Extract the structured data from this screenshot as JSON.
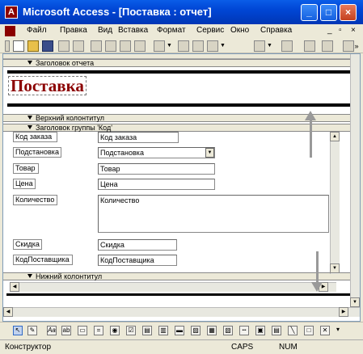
{
  "window": {
    "title": "Microsoft Access - [Поставка : отчет]",
    "buttons": [
      "minimize",
      "maximize",
      "close"
    ]
  },
  "menu": {
    "items": [
      "Файл",
      "Правка",
      "Вид",
      "Вставка",
      "Формат",
      "Сервис",
      "Окно",
      "Справка"
    ]
  },
  "report": {
    "title": "Поставка",
    "sections": {
      "report_header": "Заголовок отчета",
      "page_header": "Верхний колонтитул",
      "group_header": "Заголовок группы 'Код'",
      "page_footer": "Нижний колонтитул"
    },
    "rows": [
      {
        "label": "Код заказа",
        "field": "Код заказа"
      },
      {
        "label": "Подстановка",
        "field": "Подстановка"
      },
      {
        "label": "Товар",
        "field": "Товар"
      },
      {
        "label": "Цена",
        "field": "Цена"
      },
      {
        "label": "Количество",
        "field": "Количество"
      },
      {
        "label": "Скидка",
        "field": "Скидка"
      },
      {
        "label": "КодПоставщика",
        "field": "КодПоставщика"
      }
    ]
  },
  "status": {
    "mode": "Конструктор",
    "caps": "CAPS",
    "num": "NUM"
  },
  "colors": {
    "titlebar": "#0054e3",
    "report_title": "#8b0000",
    "chrome": "#ece9d8"
  }
}
